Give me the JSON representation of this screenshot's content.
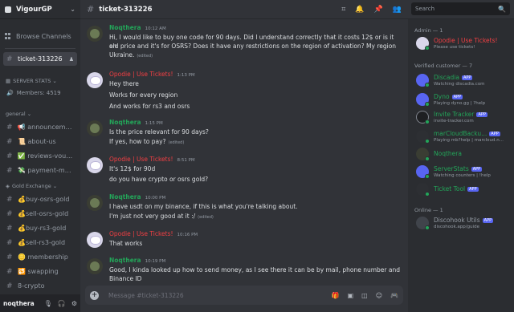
{
  "server": {
    "name": "VigourGP"
  },
  "sidebar": {
    "browse_label": "Browse Channels",
    "active_channel": "ticket-313226",
    "stats_category": "SERVER STATS",
    "members_stat": "Members: 4519",
    "general_category": "general",
    "general_channels": [
      "announceme...",
      "about-us",
      "reviews-vouc...",
      "payment-me..."
    ],
    "gold_category": "Gold Exchange",
    "gold_channels": [
      "buy-osrs-gold",
      "sell-osrs-gold",
      "buy-rs3-gold",
      "sell-rs3-gold",
      "membership",
      "swapping",
      "8-crypto"
    ],
    "user_name": "noqthera"
  },
  "topbar": {
    "channel": "ticket-313226",
    "search_placeholder": "Search"
  },
  "messages": [
    {
      "author": "Noqthera",
      "color": "#23a559",
      "time": "10:12 AM",
      "lines": [
        "Hi, I would like to buy one code for 90 days. Did I understand correctly that it costs 12$ or is it an",
        "old price and it's for OSRS? Does it have any restrictions on the region of activation? My region",
        "Ukraine."
      ],
      "edited_line": 2
    },
    {
      "author": "Opodie | Use Tickets!",
      "color": "#f23f43",
      "time": "1:13 PM",
      "lines": [
        "Hey there",
        "Works for every region",
        "And works for rs3 and osrs"
      ]
    },
    {
      "author": "Noqthera",
      "color": "#23a559",
      "time": "1:15 PM",
      "lines": [
        "Is the price relevant for 90 days?",
        "If yes, how to pay?"
      ],
      "edited_line": 1
    },
    {
      "author": "Opodie | Use Tickets!",
      "color": "#f23f43",
      "time": "8:51 PM",
      "lines": [
        "It's 12$ for 90d",
        "do you have crypto or osrs gold?"
      ]
    },
    {
      "author": "Noqthera",
      "color": "#23a559",
      "time": "10:00 PM",
      "lines": [
        "I have usdt on my binance, if this is what you're talking about.",
        "I'm just not very good at it :/"
      ],
      "edited_line": 1
    },
    {
      "author": "Opodie | Use Tickets!",
      "color": "#f23f43",
      "time": "10:16 PM",
      "lines": [
        "That works"
      ]
    },
    {
      "author": "Noqthera",
      "color": "#23a559",
      "time": "10:19 PM",
      "lines": [
        "Good, I kinda looked up how to send money, as I see there it can be by mail, phone number and",
        "Binance ID"
      ]
    }
  ],
  "edited_label": "(edited)",
  "composer": {
    "placeholder": "Message #ticket-313226"
  },
  "members_panel": {
    "admin_header": "Admin — 1",
    "verified_header": "Verified customer — 7",
    "online_header": "Online — 1",
    "app_badge": "APP",
    "admin": [
      {
        "name": "Opodie | Use Tickets!",
        "status": "Please use tickets!"
      }
    ],
    "verified": [
      {
        "name": "Discadia",
        "status": "Watching discadia.com",
        "app": true
      },
      {
        "name": "Dyno",
        "status": "Playing dyno.gg | ?help",
        "app": true
      },
      {
        "name": "Invite Tracker",
        "status": "invite-tracker.com",
        "app": true
      },
      {
        "name": "marCloudBacku...",
        "status": "Playing mb?help | marcloud.n...",
        "app": true
      },
      {
        "name": "Noqthera",
        "status": "",
        "app": false
      },
      {
        "name": "ServerStats",
        "status": "Watching counters | !help",
        "app": true
      },
      {
        "name": "Ticket Tool",
        "status": "",
        "app": true
      }
    ],
    "online": [
      {
        "name": "Discohook Utils",
        "status": "discohook.app/guide",
        "app": true
      }
    ]
  }
}
